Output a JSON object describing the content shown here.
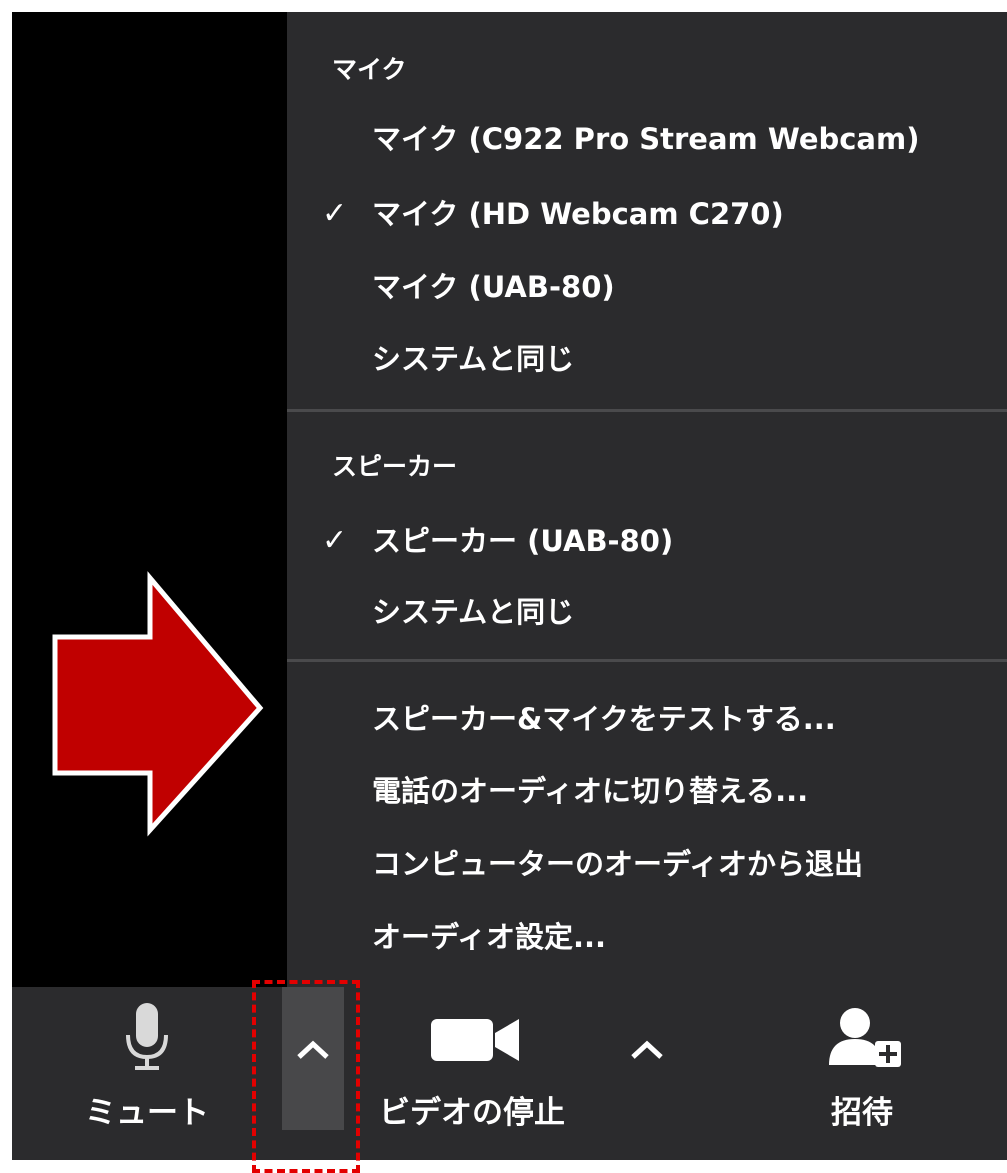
{
  "audio_menu": {
    "mic_section": {
      "header": "マイク",
      "items": [
        {
          "label": "マイク (C922 Pro Stream Webcam)",
          "checked": false
        },
        {
          "label": "マイク (HD Webcam C270)",
          "checked": true
        },
        {
          "label": "マイク (UAB-80)",
          "checked": false
        },
        {
          "label": "システムと同じ",
          "checked": false
        }
      ]
    },
    "speaker_section": {
      "header": "スピーカー",
      "items": [
        {
          "label": "スピーカー (UAB-80)",
          "checked": true
        },
        {
          "label": "システムと同じ",
          "checked": false
        }
      ]
    },
    "actions": [
      {
        "label": "スピーカー&マイクをテストする..."
      },
      {
        "label": "電話のオーディオに切り替える..."
      },
      {
        "label": "コンピューターのオーディオから退出"
      },
      {
        "label": "オーディオ設定..."
      }
    ],
    "check_glyph": "✓"
  },
  "toolbar": {
    "mute_label": "ミュート",
    "video_label": "ビデオの停止",
    "invite_label": "招待"
  },
  "icons": {
    "mic": "microphone-icon",
    "video": "video-camera-icon",
    "invite": "add-user-icon",
    "caret": "caret-up-icon"
  },
  "colors": {
    "menu_bg": "#2b2b2d",
    "caret_active_bg": "#48484a",
    "annotation_arrow": "#c00000",
    "annotation_box": "#e30000"
  }
}
